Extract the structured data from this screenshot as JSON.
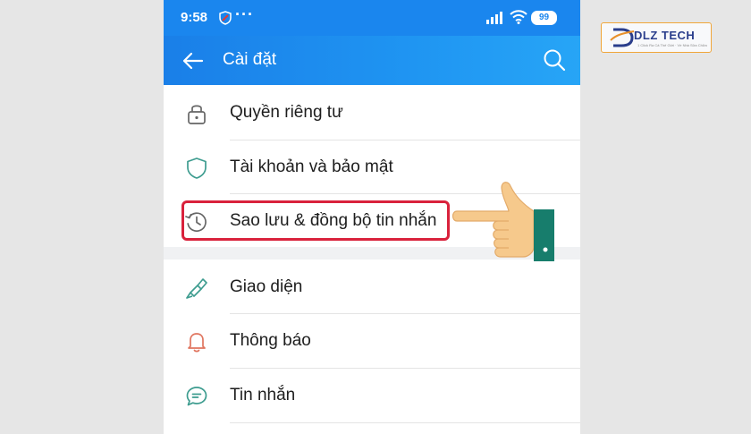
{
  "status_bar": {
    "time": "9:58",
    "dots": "···",
    "battery": "99"
  },
  "header": {
    "title": "Cài đặt"
  },
  "menu": {
    "items": [
      {
        "label": "Quyền riêng tư",
        "icon": "lock-icon"
      },
      {
        "label": "Tài khoản và bảo mật",
        "icon": "shield-icon"
      },
      {
        "label": "Sao lưu & đồng bộ tin nhắn",
        "icon": "history-clock-icon"
      },
      {
        "label": "Giao diện",
        "icon": "paintbrush-icon"
      },
      {
        "label": "Thông báo",
        "icon": "bell-icon"
      },
      {
        "label": "Tin nhắn",
        "icon": "chat-bubble-icon"
      }
    ]
  },
  "logo": {
    "text": "DLZ TECH",
    "tagline": "1 Click Ra Cả Thế Giới · Về Nhà Sửa Chữa"
  },
  "colors": {
    "header_blue": "#1f95f2",
    "icon_teal": "#3d9c8f",
    "highlight_red": "#d9223c",
    "hand_skin": "#f6c98c",
    "cuff_green": "#177d6c"
  }
}
